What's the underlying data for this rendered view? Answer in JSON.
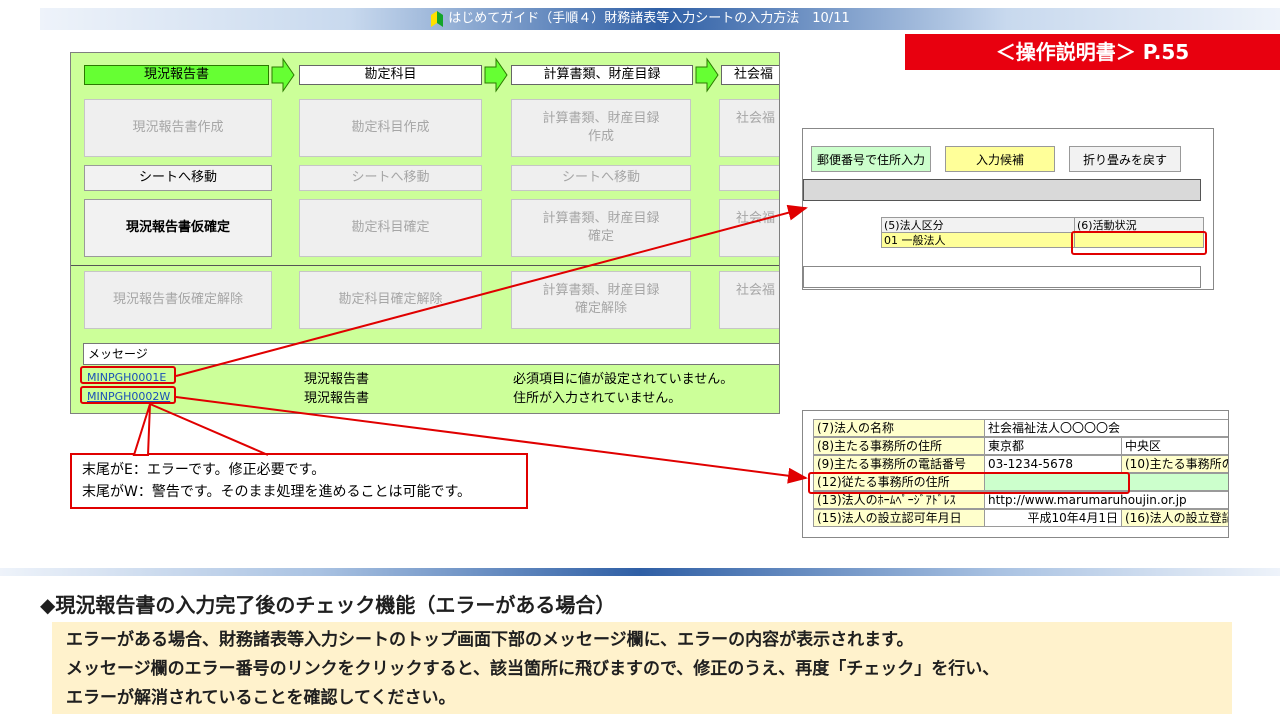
{
  "header": {
    "title": "はじめてガイド（手順４）財務諸表等入力シートの入力方法　10/11",
    "manual_ref": "＜操作説明書＞ P.55"
  },
  "panel": {
    "steps": [
      "現況報告書",
      "勘定科目",
      "計算書類、財産目録",
      "社会福"
    ],
    "buttons": {
      "row1": [
        "現況報告書作成",
        "勘定科目作成",
        "計算書類、財産目録\n作成",
        "社会福"
      ],
      "row2": [
        "シートへ移動",
        "シートへ移動",
        "シートへ移動"
      ],
      "row3": [
        "現況報告書仮確定",
        "勘定科目確定",
        "計算書類、財産目録\n確定",
        "社会福"
      ],
      "row4": [
        "現況報告書仮確定解除",
        "勘定科目確定解除",
        "計算書類、財産目録\n確定解除",
        "社会福"
      ]
    },
    "message_label": "メッセージ",
    "messages": [
      {
        "code": "MINPGH0001E",
        "sheet": "現況報告書",
        "text": "必須項目に値が設定されていません。"
      },
      {
        "code": "MINPGH0002W",
        "sheet": "現況報告書",
        "text": "住所が入力されていません。"
      }
    ]
  },
  "note": {
    "line1": "末尾がE：エラーです。修正必要です。",
    "line2": "末尾がW：警告です。そのまま処理を進めることは可能です。"
  },
  "shot1": {
    "buttons": [
      "郵便番号で住所入力",
      "入力候補",
      "折り畳みを戻す"
    ],
    "col1_header": "(5)法人区分",
    "col2_header": "(6)活動状況",
    "col1_value": "01 一般法人",
    "col2_value": ""
  },
  "shot2": {
    "rows": [
      [
        "(7)法人の名称",
        "社会福祉法人〇〇〇〇会",
        ""
      ],
      [
        "(8)主たる事務所の住所",
        "東京都",
        "中央区"
      ],
      [
        "(9)主たる事務所の電話番号",
        "03-1234-5678",
        "(10)主たる事務所の"
      ],
      [
        "(12)従たる事務所の住所",
        "",
        ""
      ],
      [
        "(13)法人のﾎｰﾑﾍﾟｰｼﾞｱﾄﾞﾚｽ",
        "http://www.marumaruhoujin.or.jp",
        ""
      ],
      [
        "(15)法人の設立認可年月日",
        "平成10年4月1日",
        "(16)法人の設立登記"
      ]
    ]
  },
  "section": {
    "title": "◆現況報告書の入力完了後のチェック機能（エラーがある場合）",
    "lines": [
      "エラーがある場合、財務諸表等入力シートのトップ画面下部のメッセージ欄に、エラーの内容が表示されます。",
      "メッセージ欄のエラー番号のリンクをクリックすると、該当箇所に飛びますので、修正のうえ、再度「チェック」を行い、",
      "エラーが解消されていることを確認してください。"
    ]
  },
  "colors": {
    "panel_green": "#ccff99",
    "active_step": "#66ff33",
    "accent_red": "#e8000f",
    "header_blue": "#2f5fa5",
    "highlight_yellow": "#ffff99",
    "desc_bg": "#fff2cc"
  }
}
